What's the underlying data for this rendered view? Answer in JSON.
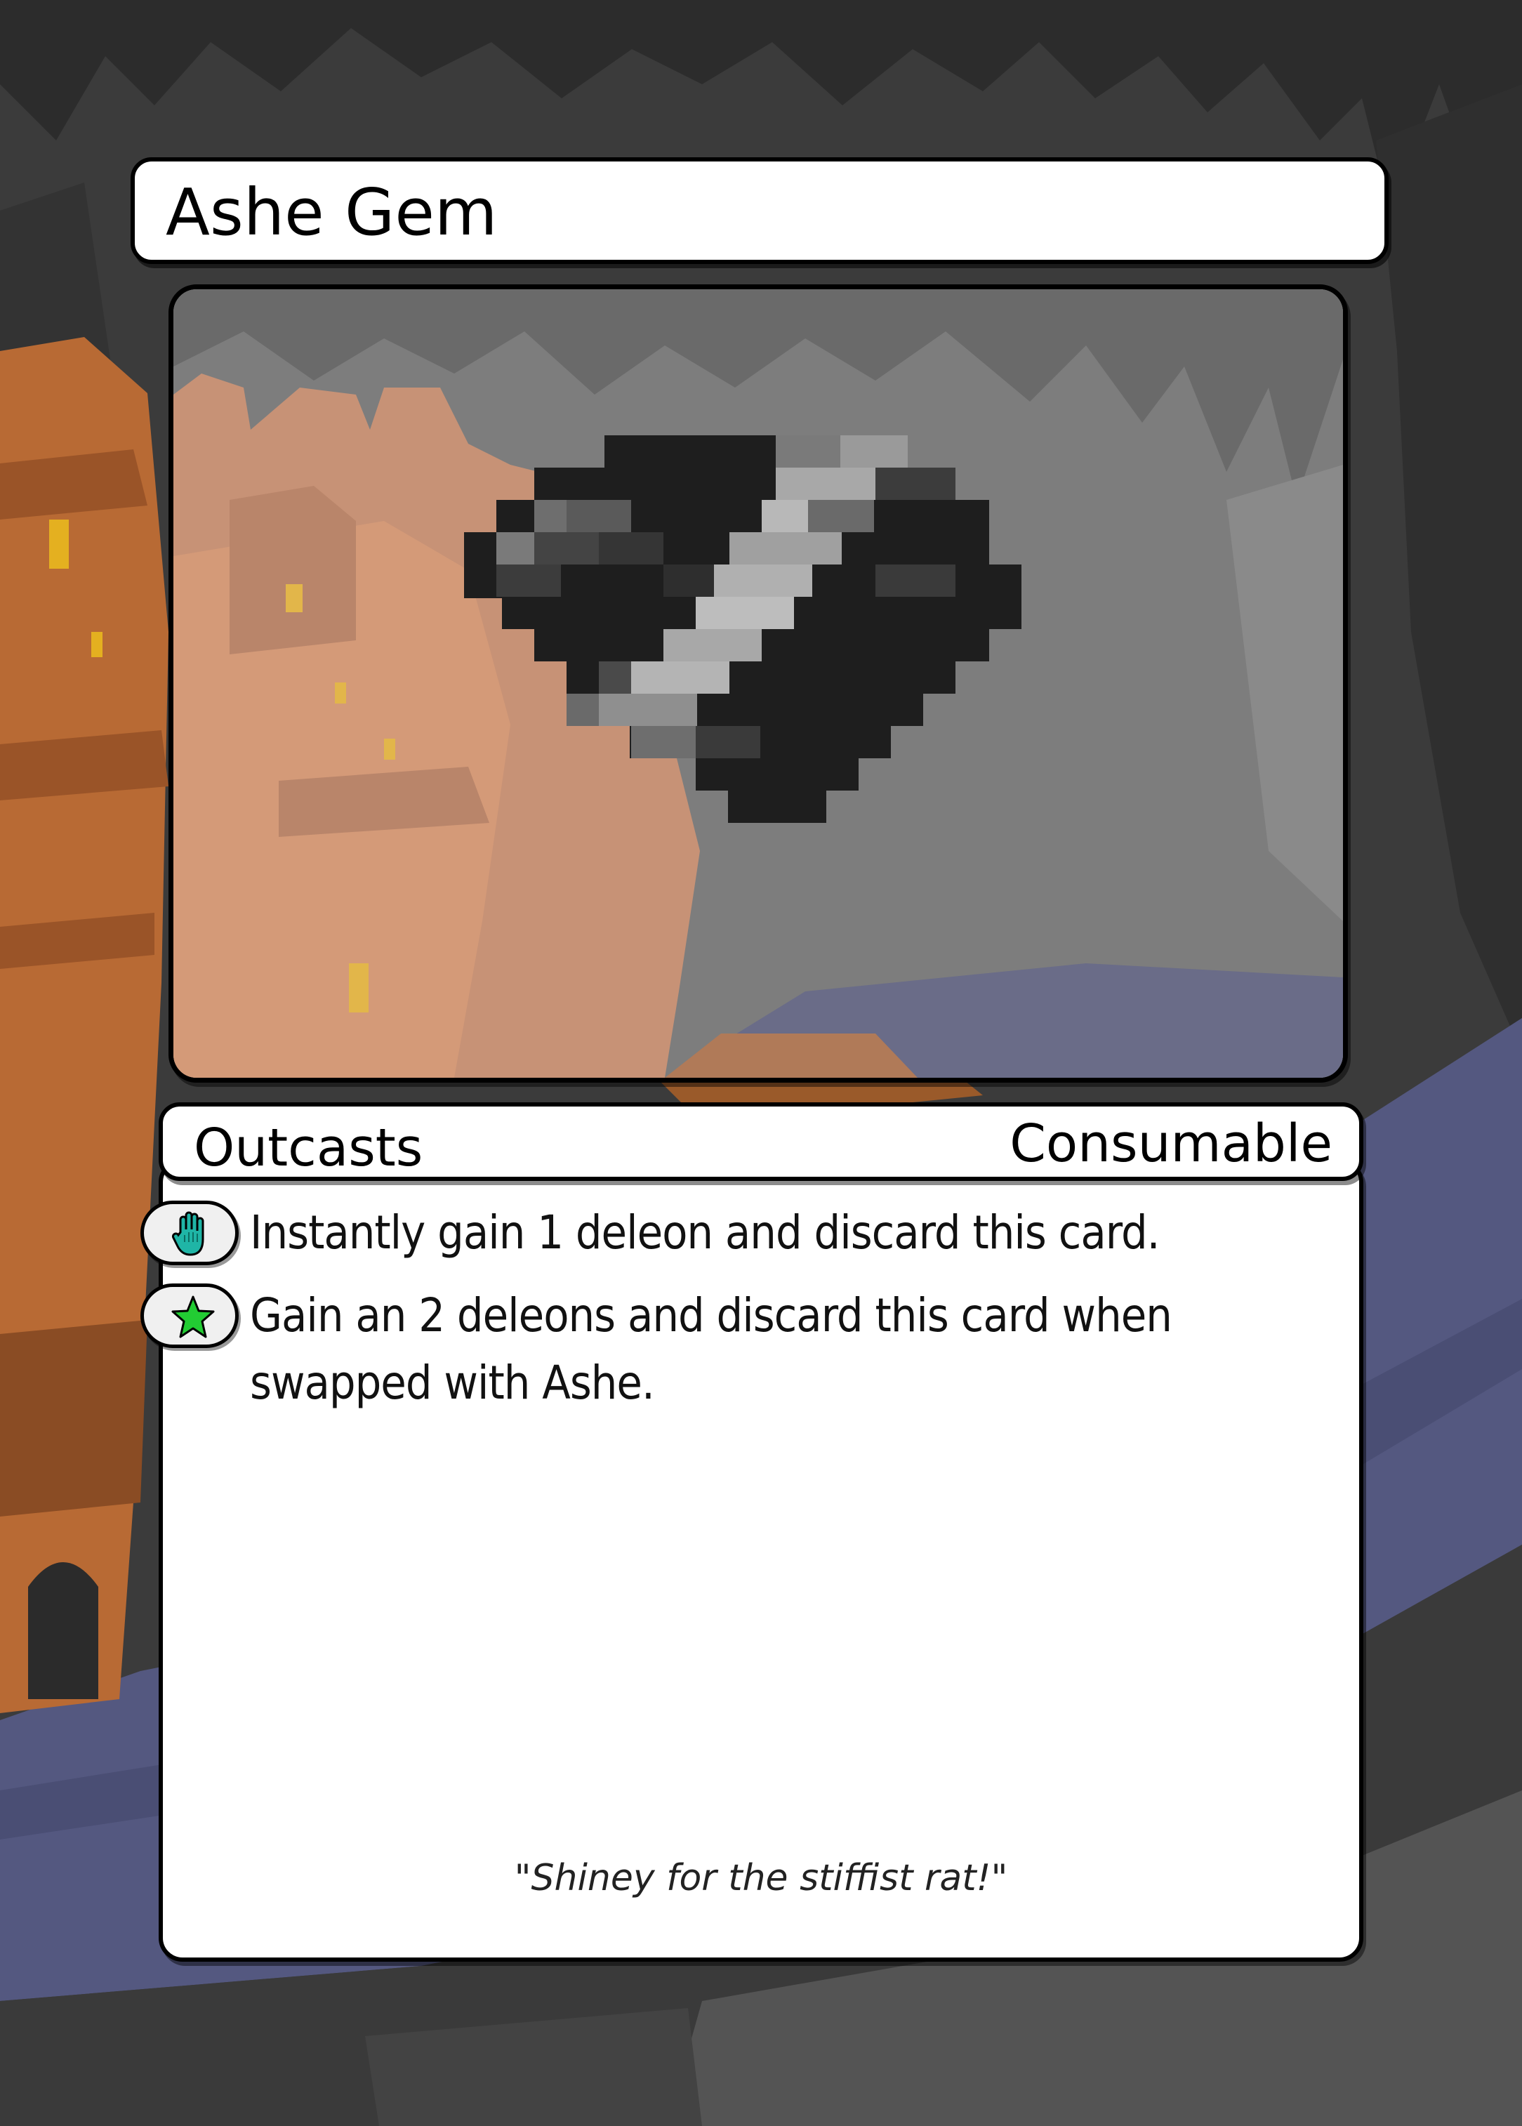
{
  "card": {
    "name": "Ashe Gem",
    "faction": "Outcasts",
    "card_type": "Consumable",
    "abilities": [
      {
        "icon": "hand-icon",
        "text": "Instantly gain 1 deleon and discard this card."
      },
      {
        "icon": "star-icon",
        "text": "Gain an 2 deleons and discard this card when swapped with Ashe."
      }
    ],
    "flavor_text": "\"Shiney for the stiffist rat!\""
  },
  "colors": {
    "cave_background": "#3a3a3a",
    "tower_orange": "#c8733a",
    "water_purple": "#545880",
    "panel_white": "#ffffff",
    "hand_icon_teal": "#1fb5a6",
    "star_icon_green": "#22cc33",
    "gem_dark": "#1e1e1e",
    "gem_highlight": "#b8b8b8"
  }
}
